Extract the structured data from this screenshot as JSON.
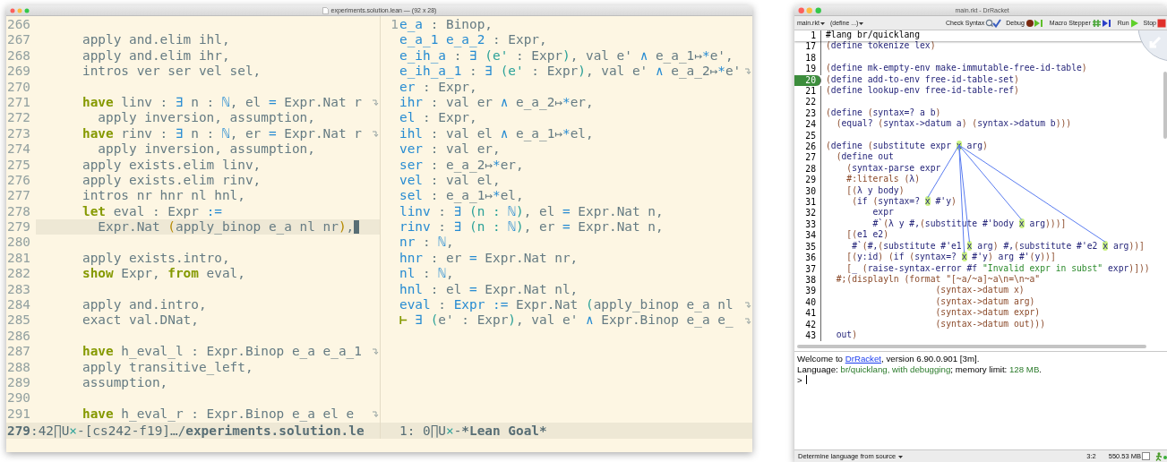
{
  "editor": {
    "title": "experiments.solution.lean — (92 x 28)",
    "source": {
      "lines": [
        {
          "number": "266",
          "selected": false,
          "truncated": false
        },
        {
          "number": "267",
          "segments": [
            {
              "text": "      apply and.elim ihl,",
              "kind": "p"
            }
          ],
          "selected": false,
          "truncated": false
        },
        {
          "number": "268",
          "segments": [
            {
              "text": "      apply and.elim ihr,",
              "kind": "p"
            }
          ],
          "selected": false,
          "truncated": false
        },
        {
          "number": "269",
          "segments": [
            {
              "text": "      intros ver ser vel sel,",
              "kind": "p"
            }
          ],
          "selected": false,
          "truncated": false
        },
        {
          "number": "270",
          "selected": false,
          "truncated": false
        },
        {
          "number": "271",
          "segments": [
            {
              "text": "      have",
              "kind": "k"
            },
            {
              "text": " linv : ",
              "kind": "p"
            },
            {
              "text": "∃",
              "kind": "o"
            },
            {
              "text": " n : ",
              "kind": "p"
            },
            {
              "text": "ℕ",
              "kind": "o"
            },
            {
              "text": ", el ",
              "kind": "p"
            },
            {
              "text": "=",
              "kind": "o"
            },
            {
              "text": " Expr.Nat r",
              "kind": "p"
            }
          ],
          "selected": false,
          "truncated": true
        },
        {
          "number": "272",
          "segments": [
            {
              "text": "        apply inversion, assumption,",
              "kind": "p"
            }
          ],
          "selected": false,
          "truncated": false
        },
        {
          "number": "273",
          "segments": [
            {
              "text": "      have",
              "kind": "k"
            },
            {
              "text": " rinv : ",
              "kind": "p"
            },
            {
              "text": "∃",
              "kind": "o"
            },
            {
              "text": " n : ",
              "kind": "p"
            },
            {
              "text": "ℕ",
              "kind": "o"
            },
            {
              "text": ", er ",
              "kind": "p"
            },
            {
              "text": "=",
              "kind": "o"
            },
            {
              "text": " Expr.Nat r",
              "kind": "p"
            }
          ],
          "selected": false,
          "truncated": true
        },
        {
          "number": "274",
          "segments": [
            {
              "text": "        apply inversion, assumption,",
              "kind": "p"
            }
          ],
          "selected": false,
          "truncated": false
        },
        {
          "number": "275",
          "segments": [
            {
              "text": "      apply exists.elim linv,",
              "kind": "p"
            }
          ],
          "selected": false,
          "truncated": false
        },
        {
          "number": "276",
          "segments": [
            {
              "text": "      apply exists.elim rinv,",
              "kind": "p"
            }
          ],
          "selected": false,
          "truncated": false
        },
        {
          "number": "277",
          "segments": [
            {
              "text": "      intros nr hnr nl hnl,",
              "kind": "p"
            }
          ],
          "selected": false,
          "truncated": false
        },
        {
          "number": "278",
          "segments": [
            {
              "text": "      let",
              "kind": "k"
            },
            {
              "text": " eval : Expr ",
              "kind": "p"
            },
            {
              "text": ":=",
              "kind": "o"
            }
          ],
          "selected": false,
          "truncated": false
        },
        {
          "number": "279",
          "segments": [
            {
              "text": "        Expr.Nat ",
              "kind": "p"
            },
            {
              "text": "(",
              "kind": "y"
            },
            {
              "text": "apply_binop e_a nl nr",
              "kind": "p"
            },
            {
              "text": ")",
              "kind": "y"
            },
            {
              "text": ",",
              "kind": "p"
            }
          ],
          "selected": true,
          "truncated": false
        },
        {
          "number": "280",
          "selected": false,
          "truncated": false
        },
        {
          "number": "281",
          "segments": [
            {
              "text": "      apply exists.intro,",
              "kind": "p"
            }
          ],
          "selected": false,
          "truncated": false
        },
        {
          "number": "282",
          "segments": [
            {
              "text": "      show",
              "kind": "k"
            },
            {
              "text": " Expr, ",
              "kind": "p"
            },
            {
              "text": "from",
              "kind": "k"
            },
            {
              "text": " eval,",
              "kind": "p"
            }
          ],
          "selected": false,
          "truncated": false
        },
        {
          "number": "283",
          "selected": false,
          "truncated": false
        },
        {
          "number": "284",
          "segments": [
            {
              "text": "      apply and.intro,",
              "kind": "p"
            }
          ],
          "selected": false,
          "truncated": false
        },
        {
          "number": "285",
          "segments": [
            {
              "text": "      exact val.DNat,",
              "kind": "p"
            }
          ],
          "selected": false,
          "truncated": false
        },
        {
          "number": "286",
          "selected": false,
          "truncated": false
        },
        {
          "number": "287",
          "segments": [
            {
              "text": "      have",
              "kind": "k"
            },
            {
              "text": " h_eval_l : Expr.Binop e_a e_a_1",
              "kind": "p"
            }
          ],
          "selected": false,
          "truncated": true
        },
        {
          "number": "288",
          "segments": [
            {
              "text": "      apply transitive_left,",
              "kind": "p"
            }
          ],
          "selected": false,
          "truncated": false
        },
        {
          "number": "289",
          "segments": [
            {
              "text": "      assumption,",
              "kind": "p"
            }
          ],
          "selected": false,
          "truncated": false
        },
        {
          "number": "290",
          "selected": false,
          "truncated": false
        },
        {
          "number": "291",
          "segments": [
            {
              "text": "      have",
              "kind": "k"
            },
            {
              "text": " h_eval_r : Expr.Binop e_a el e",
              "kind": "p"
            }
          ],
          "selected": false,
          "truncated": true
        }
      ],
      "mode_line": [
        {
          "text": "279",
          "kind": "b"
        },
        {
          "text": ":42∏U",
          "kind": "n"
        },
        {
          "text": "×",
          "kind": "t"
        },
        {
          "text": "-[cs242-f19]…/",
          "kind": "n"
        },
        {
          "text": "experiments.solution.le",
          "kind": "b"
        }
      ]
    },
    "goal": {
      "line_number": "1",
      "lines": [
        {
          "segments": [
            {
              "text": "e_a",
              "kind": "v"
            },
            {
              "text": " : Binop,",
              "kind": "p"
            }
          ],
          "truncated": false
        },
        {
          "segments": [
            {
              "text": "e_a_1 e_a_2",
              "kind": "v"
            },
            {
              "text": " : Expr,",
              "kind": "p"
            }
          ],
          "truncated": false
        },
        {
          "segments": [
            {
              "text": "e_ih_a",
              "kind": "v"
            },
            {
              "text": " : ",
              "kind": "p"
            },
            {
              "text": "∃",
              "kind": "o"
            },
            {
              "text": " (e'",
              "kind": "t"
            },
            {
              "text": " : Expr",
              "kind": "p"
            },
            {
              "text": ")",
              "kind": "t"
            },
            {
              "text": ", val e' ",
              "kind": "p"
            },
            {
              "text": "∧",
              "kind": "o"
            },
            {
              "text": " e_a_1↦",
              "kind": "p"
            },
            {
              "text": "*",
              "kind": "o"
            },
            {
              "text": "e',",
              "kind": "p"
            }
          ],
          "truncated": false
        },
        {
          "segments": [
            {
              "text": "e_ih_a_1",
              "kind": "v"
            },
            {
              "text": " : ",
              "kind": "p"
            },
            {
              "text": "∃",
              "kind": "o"
            },
            {
              "text": " (e'",
              "kind": "t"
            },
            {
              "text": " : Expr",
              "kind": "p"
            },
            {
              "text": ")",
              "kind": "t"
            },
            {
              "text": ", val e' ",
              "kind": "p"
            },
            {
              "text": "∧",
              "kind": "o"
            },
            {
              "text": " e_a_2↦",
              "kind": "p"
            },
            {
              "text": "*",
              "kind": "o"
            },
            {
              "text": "e'",
              "kind": "p"
            }
          ],
          "truncated": true
        },
        {
          "segments": [
            {
              "text": "er",
              "kind": "v"
            },
            {
              "text": " : Expr,",
              "kind": "p"
            }
          ],
          "truncated": false
        },
        {
          "segments": [
            {
              "text": "ihr",
              "kind": "v"
            },
            {
              "text": " : val er ",
              "kind": "p"
            },
            {
              "text": "∧",
              "kind": "o"
            },
            {
              "text": " e_a_2↦",
              "kind": "p"
            },
            {
              "text": "*",
              "kind": "o"
            },
            {
              "text": "er,",
              "kind": "p"
            }
          ],
          "truncated": false
        },
        {
          "segments": [
            {
              "text": "el",
              "kind": "v"
            },
            {
              "text": " : Expr,",
              "kind": "p"
            }
          ],
          "truncated": false
        },
        {
          "segments": [
            {
              "text": "ihl",
              "kind": "v"
            },
            {
              "text": " : val el ",
              "kind": "p"
            },
            {
              "text": "∧",
              "kind": "o"
            },
            {
              "text": " e_a_1↦",
              "kind": "p"
            },
            {
              "text": "*",
              "kind": "o"
            },
            {
              "text": "el,",
              "kind": "p"
            }
          ],
          "truncated": false
        },
        {
          "segments": [
            {
              "text": "ver",
              "kind": "v"
            },
            {
              "text": " : val er,",
              "kind": "p"
            }
          ],
          "truncated": false
        },
        {
          "segments": [
            {
              "text": "ser",
              "kind": "v"
            },
            {
              "text": " : e_a_2↦",
              "kind": "p"
            },
            {
              "text": "*",
              "kind": "o"
            },
            {
              "text": "er,",
              "kind": "p"
            }
          ],
          "truncated": false
        },
        {
          "segments": [
            {
              "text": "vel",
              "kind": "v"
            },
            {
              "text": " : val el,",
              "kind": "p"
            }
          ],
          "truncated": false
        },
        {
          "segments": [
            {
              "text": "sel",
              "kind": "v"
            },
            {
              "text": " : e_a_1↦",
              "kind": "p"
            },
            {
              "text": "*",
              "kind": "o"
            },
            {
              "text": "el,",
              "kind": "p"
            }
          ],
          "truncated": false
        },
        {
          "segments": [
            {
              "text": "linv",
              "kind": "v"
            },
            {
              "text": " : ",
              "kind": "p"
            },
            {
              "text": "∃",
              "kind": "o"
            },
            {
              "text": " (n : ",
              "kind": "t"
            },
            {
              "text": "ℕ",
              "kind": "o"
            },
            {
              "text": ")",
              "kind": "t"
            },
            {
              "text": ", el ",
              "kind": "p"
            },
            {
              "text": "=",
              "kind": "o"
            },
            {
              "text": " Expr.Nat n,",
              "kind": "p"
            }
          ],
          "truncated": false
        },
        {
          "segments": [
            {
              "text": "rinv",
              "kind": "v"
            },
            {
              "text": " : ",
              "kind": "p"
            },
            {
              "text": "∃",
              "kind": "o"
            },
            {
              "text": " (n : ",
              "kind": "t"
            },
            {
              "text": "ℕ",
              "kind": "o"
            },
            {
              "text": ")",
              "kind": "t"
            },
            {
              "text": ", er ",
              "kind": "p"
            },
            {
              "text": "=",
              "kind": "o"
            },
            {
              "text": " Expr.Nat n,",
              "kind": "p"
            }
          ],
          "truncated": false
        },
        {
          "segments": [
            {
              "text": "nr",
              "kind": "v"
            },
            {
              "text": " : ",
              "kind": "p"
            },
            {
              "text": "ℕ",
              "kind": "o"
            },
            {
              "text": ",",
              "kind": "p"
            }
          ],
          "truncated": false
        },
        {
          "segments": [
            {
              "text": "hnr",
              "kind": "v"
            },
            {
              "text": " : er ",
              "kind": "p"
            },
            {
              "text": "=",
              "kind": "o"
            },
            {
              "text": " Expr.Nat nr,",
              "kind": "p"
            }
          ],
          "truncated": false
        },
        {
          "segments": [
            {
              "text": "nl",
              "kind": "v"
            },
            {
              "text": " : ",
              "kind": "p"
            },
            {
              "text": "ℕ",
              "kind": "o"
            },
            {
              "text": ",",
              "kind": "p"
            }
          ],
          "truncated": false
        },
        {
          "segments": [
            {
              "text": "hnl",
              "kind": "v"
            },
            {
              "text": " : el ",
              "kind": "p"
            },
            {
              "text": "=",
              "kind": "o"
            },
            {
              "text": " Expr.Nat nl,",
              "kind": "p"
            }
          ],
          "truncated": false
        },
        {
          "segments": [
            {
              "text": "eval",
              "kind": "v"
            },
            {
              "text": " : ",
              "kind": "p"
            },
            {
              "text": "Expr",
              "kind": "v"
            },
            {
              "text": " :=",
              "kind": "o"
            },
            {
              "text": " Expr.Nat ",
              "kind": "p"
            },
            {
              "text": "(",
              "kind": "t"
            },
            {
              "text": "apply_binop e_a nl",
              "kind": "p"
            }
          ],
          "truncated": true
        },
        {
          "segments": [
            {
              "text": "⊢",
              "kind": "k"
            },
            {
              "text": " ∃",
              "kind": "o"
            },
            {
              "text": " (",
              "kind": "t"
            },
            {
              "text": "e' : Expr",
              "kind": "p"
            },
            {
              "text": ")",
              "kind": "t"
            },
            {
              "text": ", val e' ",
              "kind": "p"
            },
            {
              "text": "∧",
              "kind": "o"
            },
            {
              "text": " Expr.Binop e_a e_",
              "kind": "p"
            }
          ],
          "truncated": true
        }
      ],
      "mode_line": [
        {
          "text": "1: 0∏U",
          "kind": "n"
        },
        {
          "text": "×",
          "kind": "t"
        },
        {
          "text": "-",
          "kind": "n"
        },
        {
          "text": "*Lean Goal*",
          "kind": "b"
        }
      ]
    }
  },
  "drracket": {
    "title": "main.rkt - DrRacket",
    "toolbar": {
      "menus": [
        {
          "label": "main.rkt"
        },
        {
          "label": "(define ...)"
        }
      ],
      "buttons": [
        {
          "label": "Check Syntax",
          "kind": "check"
        },
        {
          "label": "Debug",
          "kind": "debug"
        },
        {
          "label": "Macro Stepper",
          "kind": "macro"
        },
        {
          "label": "Run",
          "kind": "run"
        },
        {
          "label": "Stop",
          "kind": "stop"
        }
      ]
    },
    "definitions": {
      "header": {
        "number": "1",
        "segments": [
          {
            "text": "#lang br/quicklang",
            "kind": "k"
          }
        ]
      },
      "lines": [
        {
          "number": "17",
          "segments": [
            {
              "text": "(",
              "kind": "p"
            },
            {
              "text": "define tokenize lex",
              "kind": "i"
            },
            {
              "text": ")",
              "kind": "p"
            }
          ],
          "selected": false
        },
        {
          "number": "18",
          "selected": false
        },
        {
          "number": "19",
          "segments": [
            {
              "text": "(",
              "kind": "p"
            },
            {
              "text": "define mk-empty-env make-immutable-free-id-table",
              "kind": "i"
            },
            {
              "text": ")",
              "kind": "p"
            }
          ],
          "selected": false
        },
        {
          "number": "20",
          "segments": [
            {
              "text": "(",
              "kind": "p"
            },
            {
              "text": "define add-to-env free-id-table-set",
              "kind": "i"
            },
            {
              "text": ")",
              "kind": "p"
            }
          ],
          "selected": true
        },
        {
          "number": "21",
          "segments": [
            {
              "text": "(",
              "kind": "p"
            },
            {
              "text": "define lookup-env free-id-table-ref",
              "kind": "i"
            },
            {
              "text": ")",
              "kind": "p"
            }
          ],
          "selected": false
        },
        {
          "number": "22",
          "selected": false
        },
        {
          "number": "23",
          "segments": [
            {
              "text": "(",
              "kind": "p"
            },
            {
              "text": "define ",
              "kind": "i"
            },
            {
              "text": "(",
              "kind": "p"
            },
            {
              "text": "syntax=? a b",
              "kind": "i"
            },
            {
              "text": ")",
              "kind": "p"
            }
          ],
          "selected": false
        },
        {
          "number": "24",
          "segments": [
            {
              "text": "  (",
              "kind": "p"
            },
            {
              "text": "equal? ",
              "kind": "i"
            },
            {
              "text": "(",
              "kind": "p"
            },
            {
              "text": "syntax->datum a",
              "kind": "i"
            },
            {
              "text": ") (",
              "kind": "p"
            },
            {
              "text": "syntax->datum b",
              "kind": "i"
            },
            {
              "text": ")))",
              "kind": "p"
            }
          ],
          "selected": false
        },
        {
          "number": "25",
          "selected": false
        },
        {
          "number": "26",
          "segments": [
            {
              "text": "(",
              "kind": "p"
            },
            {
              "text": "define ",
              "kind": "i"
            },
            {
              "text": "(",
              "kind": "p"
            },
            {
              "text": "substitute expr ",
              "kind": "i"
            },
            {
              "text": "x",
              "kind": "b"
            },
            {
              "text": " arg",
              "kind": "i"
            },
            {
              "text": ")",
              "kind": "p"
            }
          ],
          "selected": false
        },
        {
          "number": "27",
          "segments": [
            {
              "text": "  (",
              "kind": "p"
            },
            {
              "text": "define out",
              "kind": "i"
            }
          ],
          "selected": false
        },
        {
          "number": "28",
          "segments": [
            {
              "text": "    (",
              "kind": "p"
            },
            {
              "text": "syntax-parse expr",
              "kind": "i"
            }
          ],
          "selected": false
        },
        {
          "number": "29",
          "segments": [
            {
              "text": "    #:literals ",
              "kind": "c"
            },
            {
              "text": "(",
              "kind": "p"
            },
            {
              "text": "λ",
              "kind": "i"
            },
            {
              "text": ")",
              "kind": "p"
            }
          ],
          "selected": false
        },
        {
          "number": "30",
          "segments": [
            {
              "text": "    [(",
              "kind": "p"
            },
            {
              "text": "λ y body",
              "kind": "i"
            },
            {
              "text": ")",
              "kind": "p"
            }
          ],
          "selected": false
        },
        {
          "number": "31",
          "segments": [
            {
              "text": "     (",
              "kind": "p"
            },
            {
              "text": "if ",
              "kind": "i"
            },
            {
              "text": "(",
              "kind": "p"
            },
            {
              "text": "syntax=? ",
              "kind": "i"
            },
            {
              "text": "x",
              "kind": "r"
            },
            {
              "text": " #'y",
              "kind": "i"
            },
            {
              "text": ")",
              "kind": "p"
            }
          ],
          "selected": false
        },
        {
          "number": "32",
          "segments": [
            {
              "text": "         expr",
              "kind": "i"
            }
          ],
          "selected": false
        },
        {
          "number": "33",
          "segments": [
            {
              "text": "         #`",
              "kind": "i"
            },
            {
              "text": "(",
              "kind": "p"
            },
            {
              "text": "λ y #,",
              "kind": "i"
            },
            {
              "text": "(",
              "kind": "p"
            },
            {
              "text": "substitute #'body ",
              "kind": "i"
            },
            {
              "text": "x",
              "kind": "r"
            },
            {
              "text": " arg",
              "kind": "i"
            },
            {
              "text": ")))]",
              "kind": "p"
            }
          ],
          "selected": false
        },
        {
          "number": "34",
          "segments": [
            {
              "text": "    [(",
              "kind": "p"
            },
            {
              "text": "e1 e2",
              "kind": "i"
            },
            {
              "text": ")",
              "kind": "p"
            }
          ],
          "selected": false
        },
        {
          "number": "35",
          "segments": [
            {
              "text": "     #`",
              "kind": "i"
            },
            {
              "text": "(",
              "kind": "p"
            },
            {
              "text": "#,",
              "kind": "i"
            },
            {
              "text": "(",
              "kind": "p"
            },
            {
              "text": "substitute #'e1 ",
              "kind": "i"
            },
            {
              "text": "x",
              "kind": "r"
            },
            {
              "text": " arg",
              "kind": "i"
            },
            {
              "text": ") ",
              "kind": "p"
            },
            {
              "text": "#,",
              "kind": "i"
            },
            {
              "text": "(",
              "kind": "p"
            },
            {
              "text": "substitute #'e2 ",
              "kind": "i"
            },
            {
              "text": "x",
              "kind": "r"
            },
            {
              "text": " arg",
              "kind": "i"
            },
            {
              "text": "))]",
              "kind": "p"
            }
          ],
          "selected": false
        },
        {
          "number": "36",
          "segments": [
            {
              "text": "    [(",
              "kind": "p"
            },
            {
              "text": "y:id",
              "kind": "i"
            },
            {
              "text": ") (",
              "kind": "p"
            },
            {
              "text": "if ",
              "kind": "i"
            },
            {
              "text": "(",
              "kind": "p"
            },
            {
              "text": "syntax=? ",
              "kind": "i"
            },
            {
              "text": "x",
              "kind": "r"
            },
            {
              "text": " #'y",
              "kind": "i"
            },
            {
              "text": ") ",
              "kind": "p"
            },
            {
              "text": "arg #'",
              "kind": "i"
            },
            {
              "text": "(",
              "kind": "p"
            },
            {
              "text": "y",
              "kind": "i"
            },
            {
              "text": "))]",
              "kind": "p"
            }
          ],
          "selected": false
        },
        {
          "number": "37",
          "segments": [
            {
              "text": "    [",
              "kind": "p"
            },
            {
              "text": "_ ",
              "kind": "i"
            },
            {
              "text": "(",
              "kind": "p"
            },
            {
              "text": "raise-syntax-error #f ",
              "kind": "i"
            },
            {
              "text": "\"Invalid expr in subst\"",
              "kind": "s"
            },
            {
              "text": " expr",
              "kind": "i"
            },
            {
              "text": ")]))",
              "kind": "p"
            }
          ],
          "selected": false
        },
        {
          "number": "38",
          "segments": [
            {
              "text": "  #;(displayln (format \"[~a/~a]~a\\n=\\n~a\"",
              "kind": "c"
            }
          ],
          "selected": false
        },
        {
          "number": "39",
          "segments": [
            {
              "text": "                     (syntax->datum x)",
              "kind": "c"
            }
          ],
          "selected": false
        },
        {
          "number": "40",
          "segments": [
            {
              "text": "                     (syntax->datum arg)",
              "kind": "c"
            }
          ],
          "selected": false
        },
        {
          "number": "41",
          "segments": [
            {
              "text": "                     (syntax->datum expr)",
              "kind": "c"
            }
          ],
          "selected": false
        },
        {
          "number": "42",
          "segments": [
            {
              "text": "                     (syntax->datum out)))",
              "kind": "c"
            }
          ],
          "selected": false
        },
        {
          "number": "43",
          "segments": [
            {
              "text": "  out",
              "kind": "i"
            },
            {
              "text": ")",
              "kind": "p"
            }
          ],
          "selected": false
        }
      ]
    },
    "interactions": {
      "lines": [
        {
          "segments": [
            {
              "text": "Welcome to ",
              "kind": "n"
            },
            {
              "text": "DrRacket",
              "kind": "l"
            },
            {
              "text": ", version 6.90.0.901 [3m].",
              "kind": "n"
            }
          ]
        },
        {
          "segments": [
            {
              "text": "Language: ",
              "kind": "n"
            },
            {
              "text": "br/quicklang, with debugging",
              "kind": "g"
            },
            {
              "text": "; memory limit: ",
              "kind": "n"
            },
            {
              "text": "128 MB",
              "kind": "g"
            },
            {
              "text": ".",
              "kind": "n"
            }
          ]
        }
      ],
      "prompt": ">"
    },
    "status_bar": {
      "language": "Determine language from source",
      "position": "3:2",
      "memory": "550.53 MB"
    }
  }
}
